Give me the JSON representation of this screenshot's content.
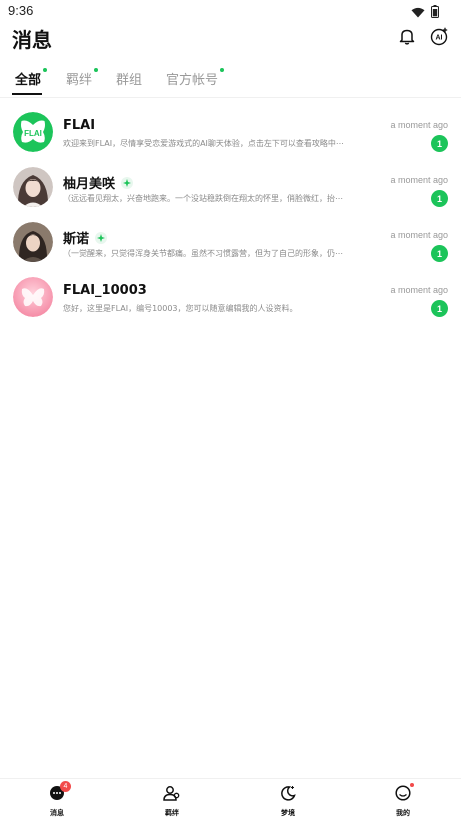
{
  "status_bar": {
    "time": "9:36"
  },
  "header": {
    "title": "消息"
  },
  "tabs": [
    {
      "label": "全部",
      "active": true,
      "dot": true
    },
    {
      "label": "羁绊",
      "active": false,
      "dot": true
    },
    {
      "label": "群组",
      "active": false,
      "dot": false
    },
    {
      "label": "官方帐号",
      "active": false,
      "dot": true
    }
  ],
  "conversations": [
    {
      "name": "FLAI",
      "time": "a moment ago",
      "preview": "欢迎来到FLAI，尽情享受恋爱游戏式的AI聊天体验，点击左下可以查看攻略中⋯",
      "unread": "1",
      "verified": false,
      "avatar": "flai-logo"
    },
    {
      "name": "柚月美咲",
      "time": "a moment ago",
      "preview": "（远远看见翔太，兴奋地跑来。一个没站稳跌倒在翔太的怀里，俏脸微红，抬⋯",
      "unread": "1",
      "verified": true,
      "avatar": "anime-girl-1"
    },
    {
      "name": "斯诺",
      "time": "a moment ago",
      "preview": "（一觉醒来，只觉得浑身关节都痛。虽然不习惯露营，但为了自己的形象，仍⋯",
      "unread": "1",
      "verified": true,
      "avatar": "anime-girl-2"
    },
    {
      "name": "FLAI_10003",
      "time": "a moment ago",
      "preview": "您好，这里是FLAI，编号10003，您可以随意编辑我的人设资料。",
      "unread": "1",
      "verified": false,
      "avatar": "pink-butterfly"
    }
  ],
  "bottom_nav": [
    {
      "label": "消息",
      "icon": "chat-icon",
      "badge": "4"
    },
    {
      "label": "羁绊",
      "icon": "users-icon",
      "badge": ""
    },
    {
      "label": "梦境",
      "icon": "moon-icon",
      "badge": ""
    },
    {
      "label": "我的",
      "icon": "profile-icon",
      "badge": "dot"
    }
  ],
  "colors": {
    "accent": "#1cc45a",
    "badge_red": "#f24b4b",
    "text_primary": "#111111",
    "text_muted": "#8a8a8a"
  }
}
